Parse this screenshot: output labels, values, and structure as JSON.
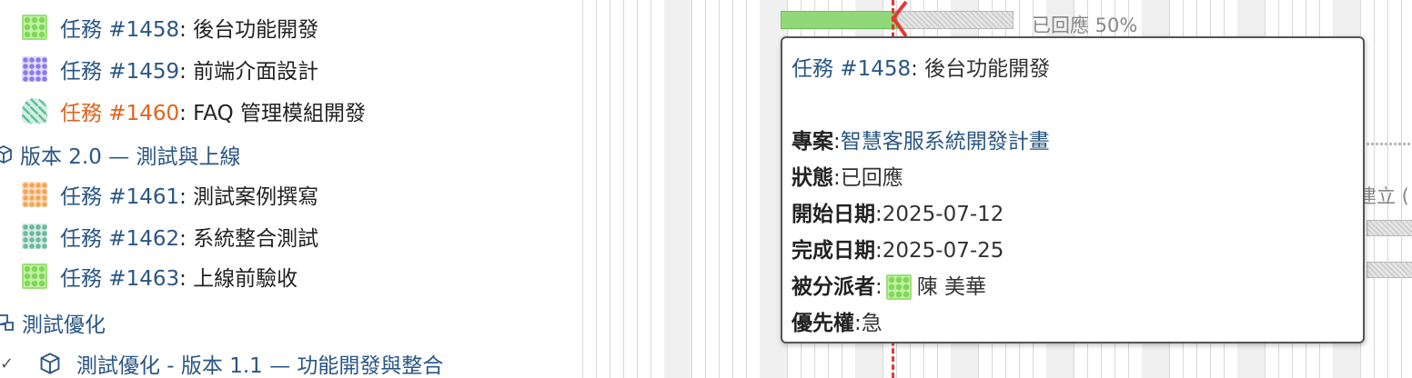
{
  "tree": {
    "issues_top": [
      {
        "link": "任務 #1458",
        "title": ": 後台功能開發",
        "avatar": "green",
        "overdue": false
      },
      {
        "link": "任務 #1459",
        "title": ": 前端介面設計",
        "avatar": "purple",
        "overdue": false
      },
      {
        "link": "任務 #1460",
        "title": ": FAQ 管理模組開發",
        "avatar": "teal",
        "overdue": true
      }
    ],
    "version": {
      "label": "版本 2.0 — 測試與上線",
      "icon": "package-icon"
    },
    "issues_bottom": [
      {
        "link": "任務 #1461",
        "title": ": 測試案例撰寫",
        "avatar": "orange"
      },
      {
        "link": "任務 #1462",
        "title": ": 系統整合測試",
        "avatar": "sage"
      },
      {
        "link": "任務 #1463",
        "title": ": 上線前驗收",
        "avatar": "green"
      }
    ],
    "project": {
      "label": "測試優化",
      "icon": "project-icon"
    },
    "sub_version": {
      "label": "測試優化 - 版本 1.1 — 功能開發與整合",
      "icon": "package-icon",
      "caret": "✓"
    }
  },
  "gantt": {
    "bar_label": "已回應 50%",
    "side_label": "建立 (",
    "progress_percent": 50,
    "colors": {
      "done": "#90d878",
      "today": "#e53935"
    }
  },
  "tooltip": {
    "issue_link": "任務 #1458",
    "issue_title": ": 後台功能開發",
    "project_label": "專案",
    "project_value": "智慧客服系統開發計畫",
    "status_label": "狀態",
    "status_value": "已回應",
    "start_label": "開始日期",
    "start_value": "2025-07-12",
    "due_label": "完成日期",
    "due_value": "2025-07-25",
    "assignee_label": "被分派者",
    "assignee_value": "陳 美華",
    "priority_label": "優先權",
    "priority_value": "急",
    "sep": ": "
  }
}
